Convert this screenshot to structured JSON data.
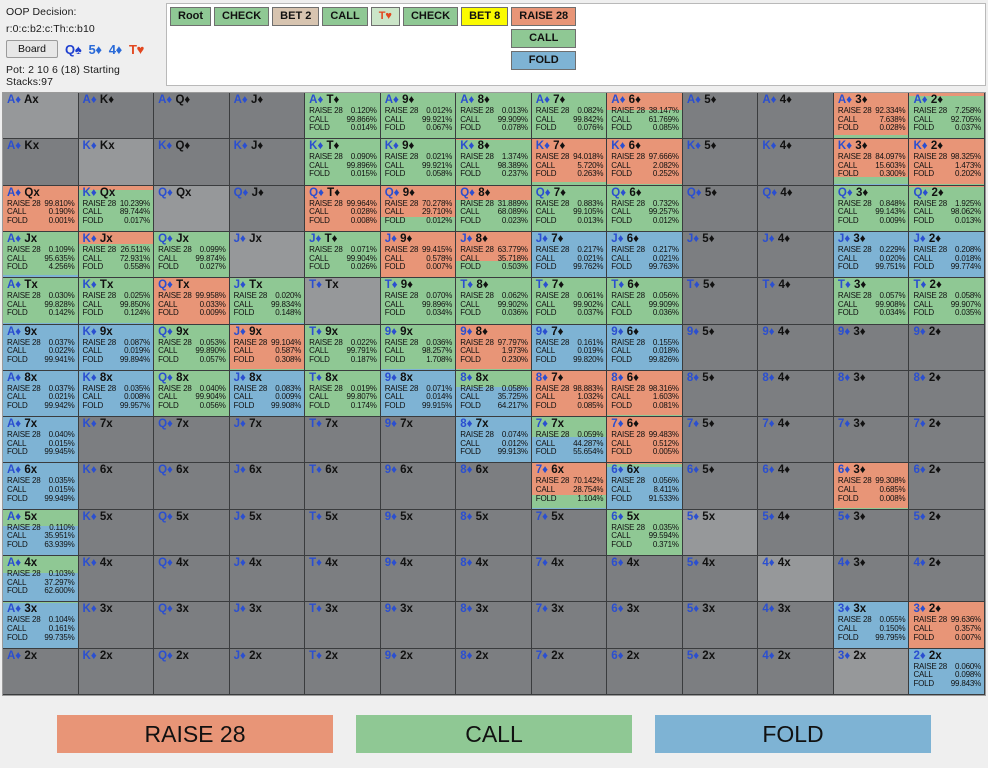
{
  "header": {
    "decision_label": "OOP Decision:",
    "node_path": "r:0:c:b2:c:Th:c:b10",
    "board_button": "Board",
    "board_cards": [
      {
        "text": "Q♠",
        "suit": "spade"
      },
      {
        "text": "5♦",
        "suit": "diamond"
      },
      {
        "text": "4♦",
        "suit": "diamond"
      },
      {
        "text": "T♥",
        "suit": "heart"
      }
    ],
    "pot_line": "Pot: 2 10 6 (18) Starting Stacks:97"
  },
  "tree": {
    "nodes": [
      {
        "label": "Root",
        "style": "n-green"
      },
      {
        "label": "CHECK",
        "style": "n-green"
      },
      {
        "label": "BET 2",
        "style": "n-tan"
      },
      {
        "label": "CALL",
        "style": "n-green"
      },
      {
        "label": "T♥",
        "style": "n-card"
      },
      {
        "label": "CHECK",
        "style": "n-green"
      },
      {
        "label": "BET 8",
        "style": "n-yellow"
      }
    ],
    "branch": [
      {
        "label": "RAISE 28",
        "style": "n-raise"
      },
      {
        "label": "CALL",
        "style": "n-call"
      },
      {
        "label": "FOLD",
        "style": "n-fold"
      }
    ]
  },
  "legend": {
    "raise": "RAISE 28",
    "call": "CALL",
    "fold": "FOLD"
  },
  "grid": {
    "action_keys": [
      "RAISE 28",
      "CALL",
      "FOLD"
    ],
    "rows": [
      [
        {
          "t": "A♦ Ax",
          "diag": true
        },
        {
          "t": "A♦ K♦"
        },
        {
          "t": "A♦ Q♦"
        },
        {
          "t": "A♦ J♦"
        },
        {
          "t": "A♦ T♦",
          "v": [
            0.12,
            99.866,
            0.014
          ]
        },
        {
          "t": "A♦ 9♦",
          "v": [
            0.012,
            99.921,
            0.067
          ]
        },
        {
          "t": "A♦ 8♦",
          "v": [
            0.013,
            99.909,
            0.078
          ]
        },
        {
          "t": "A♦ 7♦",
          "v": [
            0.082,
            99.842,
            0.076
          ]
        },
        {
          "t": "A♦ 6♦",
          "v": [
            38.147,
            61.769,
            0.085
          ]
        },
        {
          "t": "A♦ 5♦"
        },
        {
          "t": "A♦ 4♦"
        },
        {
          "t": "A♦ 3♦",
          "v": [
            92.334,
            7.638,
            0.028
          ]
        },
        {
          "t": "A♦ 2♦",
          "v": [
            7.258,
            92.705,
            0.037
          ]
        }
      ],
      [
        {
          "t": "A♦ Kx"
        },
        {
          "t": "K♦ Kx",
          "diag": true
        },
        {
          "t": "K♦ Q♦"
        },
        {
          "t": "K♦ J♦"
        },
        {
          "t": "K♦ T♦",
          "v": [
            0.09,
            99.896,
            0.015
          ]
        },
        {
          "t": "K♦ 9♦",
          "v": [
            0.021,
            99.921,
            0.058
          ]
        },
        {
          "t": "K♦ 8♦",
          "v": [
            1.374,
            98.389,
            0.237
          ]
        },
        {
          "t": "K♦ 7♦",
          "v": [
            94.018,
            5.72,
            0.263
          ]
        },
        {
          "t": "K♦ 6♦",
          "v": [
            97.666,
            2.082,
            0.252
          ]
        },
        {
          "t": "K♦ 5♦"
        },
        {
          "t": "K♦ 4♦"
        },
        {
          "t": "K♦ 3♦",
          "v": [
            84.097,
            15.603,
            0.3
          ]
        },
        {
          "t": "K♦ 2♦",
          "v": [
            98.325,
            1.473,
            0.202
          ]
        }
      ],
      [
        {
          "t": "A♦ Qx",
          "v": [
            99.81,
            0.19,
            0.001
          ]
        },
        {
          "t": "K♦ Qx",
          "v": [
            10.239,
            89.744,
            0.017
          ]
        },
        {
          "t": "Q♦ Qx",
          "diag": true
        },
        {
          "t": "Q♦ J♦"
        },
        {
          "t": "Q♦ T♦",
          "v": [
            99.964,
            0.028,
            0.008
          ]
        },
        {
          "t": "Q♦ 9♦",
          "v": [
            70.278,
            29.71,
            0.012
          ]
        },
        {
          "t": "Q♦ 8♦",
          "v": [
            31.889,
            68.089,
            0.023
          ]
        },
        {
          "t": "Q♦ 7♦",
          "v": [
            0.883,
            99.105,
            0.013
          ]
        },
        {
          "t": "Q♦ 6♦",
          "v": [
            0.732,
            99.257,
            0.012
          ]
        },
        {
          "t": "Q♦ 5♦"
        },
        {
          "t": "Q♦ 4♦"
        },
        {
          "t": "Q♦ 3♦",
          "v": [
            0.848,
            99.143,
            0.009
          ]
        },
        {
          "t": "Q♦ 2♦",
          "v": [
            1.925,
            98.062,
            0.013
          ]
        }
      ],
      [
        {
          "t": "A♦ Jx",
          "v": [
            0.109,
            95.635,
            4.256
          ]
        },
        {
          "t": "K♦ Jx",
          "v": [
            26.511,
            72.931,
            0.558
          ]
        },
        {
          "t": "Q♦ Jx",
          "v": [
            0.099,
            99.874,
            0.027
          ]
        },
        {
          "t": "J♦ Jx",
          "diag": true
        },
        {
          "t": "J♦ T♦",
          "v": [
            0.071,
            99.904,
            0.026
          ]
        },
        {
          "t": "J♦ 9♦",
          "v": [
            99.415,
            0.578,
            0.007
          ]
        },
        {
          "t": "J♦ 8♦",
          "v": [
            63.779,
            35.718,
            0.503
          ]
        },
        {
          "t": "J♦ 7♦",
          "v": [
            0.217,
            0.021,
            99.762
          ]
        },
        {
          "t": "J♦ 6♦",
          "v": [
            0.217,
            0.021,
            99.763
          ]
        },
        {
          "t": "J♦ 5♦"
        },
        {
          "t": "J♦ 4♦"
        },
        {
          "t": "J♦ 3♦",
          "v": [
            0.229,
            0.02,
            99.751
          ]
        },
        {
          "t": "J♦ 2♦",
          "v": [
            0.208,
            0.018,
            99.774
          ]
        }
      ],
      [
        {
          "t": "A♦ Tx",
          "v": [
            0.03,
            99.828,
            0.142
          ]
        },
        {
          "t": "K♦ Tx",
          "v": [
            0.025,
            99.85,
            0.124
          ]
        },
        {
          "t": "Q♦ Tx",
          "v": [
            99.958,
            0.033,
            0.009
          ]
        },
        {
          "t": "J♦ Tx",
          "v": [
            0.02,
            99.834,
            0.148
          ]
        },
        {
          "t": "T♦ Tx",
          "diag": true
        },
        {
          "t": "T♦ 9♦",
          "v": [
            0.07,
            99.896,
            0.034
          ]
        },
        {
          "t": "T♦ 8♦",
          "v": [
            0.062,
            99.902,
            0.036
          ]
        },
        {
          "t": "T♦ 7♦",
          "v": [
            0.061,
            99.902,
            0.037
          ]
        },
        {
          "t": "T♦ 6♦",
          "v": [
            0.056,
            99.909,
            0.036
          ]
        },
        {
          "t": "T♦ 5♦"
        },
        {
          "t": "T♦ 4♦"
        },
        {
          "t": "T♦ 3♦",
          "v": [
            0.057,
            99.908,
            0.034
          ]
        },
        {
          "t": "T♦ 2♦",
          "v": [
            0.058,
            99.907,
            0.035
          ]
        }
      ],
      [
        {
          "t": "A♦ 9x",
          "v": [
            0.037,
            0.022,
            99.941
          ]
        },
        {
          "t": "K♦ 9x",
          "v": [
            0.087,
            0.019,
            99.894
          ]
        },
        {
          "t": "Q♦ 9x",
          "v": [
            0.053,
            99.89,
            0.057
          ]
        },
        {
          "t": "J♦ 9x",
          "v": [
            99.104,
            0.587,
            0.308
          ]
        },
        {
          "t": "T♦ 9x",
          "v": [
            0.022,
            99.791,
            0.187
          ]
        },
        {
          "t": "9♦ 9x",
          "diag": true,
          "v": [
            0.036,
            98.257,
            1.708
          ]
        },
        {
          "t": "9♦ 8♦",
          "v": [
            97.797,
            1.973,
            0.23
          ]
        },
        {
          "t": "9♦ 7♦",
          "v": [
            0.161,
            0.019,
            99.82
          ]
        },
        {
          "t": "9♦ 6♦",
          "v": [
            0.155,
            0.018,
            99.826
          ]
        },
        {
          "t": "9♦ 5♦"
        },
        {
          "t": "9♦ 4♦"
        },
        {
          "t": "9♦ 3♦"
        },
        {
          "t": "9♦ 2♦"
        }
      ],
      [
        {
          "t": "A♦ 8x",
          "v": [
            0.037,
            0.021,
            99.942
          ]
        },
        {
          "t": "K♦ 8x",
          "v": [
            0.035,
            0.008,
            99.957
          ]
        },
        {
          "t": "Q♦ 8x",
          "v": [
            0.04,
            99.904,
            0.056
          ]
        },
        {
          "t": "J♦ 8x",
          "v": [
            0.083,
            0.009,
            99.908
          ]
        },
        {
          "t": "T♦ 8x",
          "v": [
            0.019,
            99.807,
            0.174
          ]
        },
        {
          "t": "9♦ 8x",
          "v": [
            0.071,
            0.014,
            99.915
          ]
        },
        {
          "t": "8♦ 8x",
          "diag": true,
          "v": [
            0.058,
            35.725,
            64.217
          ]
        },
        {
          "t": "8♦ 7♦",
          "v": [
            98.883,
            1.032,
            0.085
          ]
        },
        {
          "t": "8♦ 6♦",
          "v": [
            98.316,
            1.603,
            0.081
          ]
        },
        {
          "t": "8♦ 5♦"
        },
        {
          "t": "8♦ 4♦"
        },
        {
          "t": "8♦ 3♦"
        },
        {
          "t": "8♦ 2♦"
        }
      ],
      [
        {
          "t": "A♦ 7x",
          "v": [
            0.04,
            0.015,
            99.945
          ]
        },
        {
          "t": "K♦ 7x"
        },
        {
          "t": "Q♦ 7x"
        },
        {
          "t": "J♦ 7x"
        },
        {
          "t": "T♦ 7x"
        },
        {
          "t": "9♦ 7x"
        },
        {
          "t": "8♦ 7x",
          "v": [
            0.074,
            0.012,
            99.913
          ]
        },
        {
          "t": "7♦ 7x",
          "diag": true,
          "v": [
            0.059,
            44.287,
            55.654
          ]
        },
        {
          "t": "7♦ 6♦",
          "v": [
            99.483,
            0.512,
            0.005
          ]
        },
        {
          "t": "7♦ 5♦"
        },
        {
          "t": "7♦ 4♦"
        },
        {
          "t": "7♦ 3♦"
        },
        {
          "t": "7♦ 2♦"
        }
      ],
      [
        {
          "t": "A♦ 6x",
          "v": [
            0.035,
            0.015,
            99.949
          ]
        },
        {
          "t": "K♦ 6x"
        },
        {
          "t": "Q♦ 6x"
        },
        {
          "t": "J♦ 6x"
        },
        {
          "t": "T♦ 6x"
        },
        {
          "t": "9♦ 6x"
        },
        {
          "t": "8♦ 6x"
        },
        {
          "t": "7♦ 6x",
          "v": [
            70.142,
            28.754,
            1.104
          ]
        },
        {
          "t": "6♦ 6x",
          "diag": true,
          "v": [
            0.056,
            8.411,
            91.533
          ]
        },
        {
          "t": "6♦ 5♦"
        },
        {
          "t": "6♦ 4♦"
        },
        {
          "t": "6♦ 3♦",
          "v": [
            99.308,
            0.685,
            0.008
          ]
        },
        {
          "t": "6♦ 2♦"
        }
      ],
      [
        {
          "t": "A♦ 5x",
          "v": [
            0.11,
            35.951,
            63.939
          ]
        },
        {
          "t": "K♦ 5x"
        },
        {
          "t": "Q♦ 5x"
        },
        {
          "t": "J♦ 5x"
        },
        {
          "t": "T♦ 5x"
        },
        {
          "t": "9♦ 5x"
        },
        {
          "t": "8♦ 5x"
        },
        {
          "t": "7♦ 5x"
        },
        {
          "t": "6♦ 5x",
          "v": [
            0.035,
            99.594,
            0.371
          ]
        },
        {
          "t": "5♦ 5x",
          "diag": true
        },
        {
          "t": "5♦ 4♦"
        },
        {
          "t": "5♦ 3♦"
        },
        {
          "t": "5♦ 2♦"
        }
      ],
      [
        {
          "t": "A♦ 4x",
          "v": [
            0.103,
            37.297,
            62.6
          ]
        },
        {
          "t": "K♦ 4x"
        },
        {
          "t": "Q♦ 4x"
        },
        {
          "t": "J♦ 4x"
        },
        {
          "t": "T♦ 4x"
        },
        {
          "t": "9♦ 4x"
        },
        {
          "t": "8♦ 4x"
        },
        {
          "t": "7♦ 4x"
        },
        {
          "t": "6♦ 4x"
        },
        {
          "t": "5♦ 4x"
        },
        {
          "t": "4♦ 4x",
          "diag": true
        },
        {
          "t": "4♦ 3♦"
        },
        {
          "t": "4♦ 2♦"
        }
      ],
      [
        {
          "t": "A♦ 3x",
          "v": [
            0.104,
            0.161,
            99.735
          ]
        },
        {
          "t": "K♦ 3x"
        },
        {
          "t": "Q♦ 3x"
        },
        {
          "t": "J♦ 3x"
        },
        {
          "t": "T♦ 3x"
        },
        {
          "t": "9♦ 3x"
        },
        {
          "t": "8♦ 3x"
        },
        {
          "t": "7♦ 3x"
        },
        {
          "t": "6♦ 3x"
        },
        {
          "t": "5♦ 3x"
        },
        {
          "t": "4♦ 3x"
        },
        {
          "t": "3♦ 3x",
          "diag": true,
          "v": [
            0.055,
            0.15,
            99.795
          ]
        },
        {
          "t": "3♦ 2♦",
          "v": [
            99.636,
            0.357,
            0.007
          ]
        }
      ],
      [
        {
          "t": "A♦ 2x"
        },
        {
          "t": "K♦ 2x"
        },
        {
          "t": "Q♦ 2x"
        },
        {
          "t": "J♦ 2x"
        },
        {
          "t": "T♦ 2x"
        },
        {
          "t": "9♦ 2x"
        },
        {
          "t": "8♦ 2x"
        },
        {
          "t": "7♦ 2x"
        },
        {
          "t": "6♦ 2x"
        },
        {
          "t": "5♦ 2x"
        },
        {
          "t": "4♦ 2x"
        },
        {
          "t": "3♦ 2x",
          "diag": true
        },
        {
          "t": "2♦ 2x",
          "diag": true,
          "v": [
            0.06,
            0.098,
            99.843
          ]
        }
      ]
    ]
  }
}
